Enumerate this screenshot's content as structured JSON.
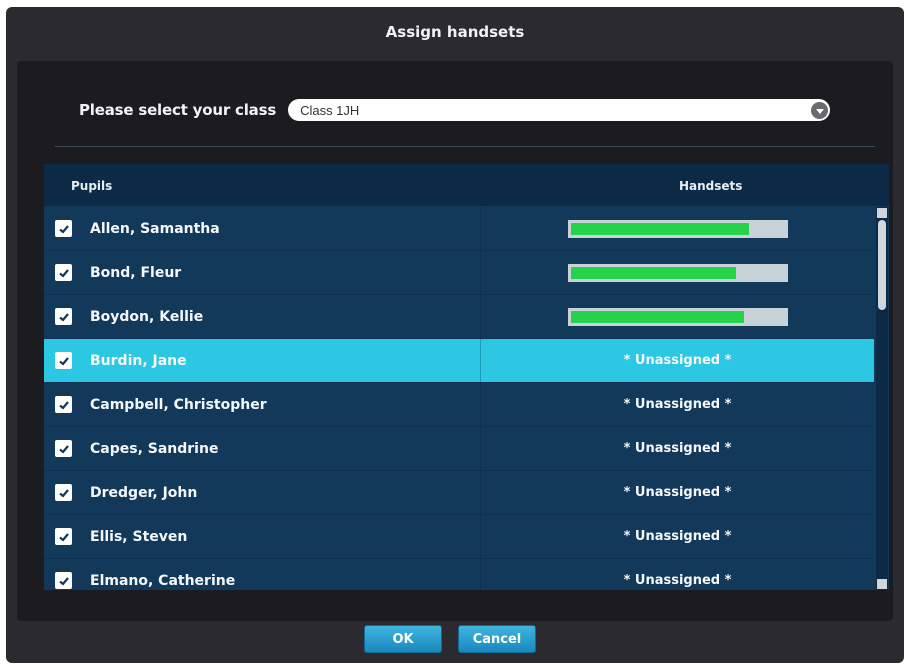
{
  "dialog": {
    "title": "Assign handsets"
  },
  "class_select": {
    "label": "Please select your class",
    "value": "Class 1JH"
  },
  "table": {
    "headers": {
      "pupils": "Pupils",
      "handsets": "Handsets"
    },
    "rows": [
      {
        "name": "Allen, Samantha",
        "checked": true,
        "handset_type": "bar",
        "battery": 0.83
      },
      {
        "name": "Bond, Fleur",
        "checked": true,
        "handset_type": "bar",
        "battery": 0.77
      },
      {
        "name": "Boydon, Kellie",
        "checked": true,
        "handset_type": "bar",
        "battery": 0.81
      },
      {
        "name": "Burdin, Jane",
        "checked": true,
        "handset_type": "text",
        "handset": "* Unassigned *",
        "selected": true
      },
      {
        "name": "Campbell, Christopher",
        "checked": true,
        "handset_type": "text",
        "handset": "* Unassigned *"
      },
      {
        "name": "Capes, Sandrine",
        "checked": true,
        "handset_type": "text",
        "handset": "* Unassigned *"
      },
      {
        "name": "Dredger, John",
        "checked": true,
        "handset_type": "text",
        "handset": "* Unassigned *"
      },
      {
        "name": "Ellis, Steven",
        "checked": true,
        "handset_type": "text",
        "handset": "* Unassigned *"
      },
      {
        "name": "Elmano, Catherine",
        "checked": true,
        "handset_type": "text",
        "handset": "* Unassigned *"
      }
    ]
  },
  "buttons": {
    "ok": "OK",
    "cancel": "Cancel"
  },
  "colors": {
    "selected_row": "#2cc7e3",
    "battery_fill": "#25d24a",
    "button": "#2a9fd0"
  }
}
